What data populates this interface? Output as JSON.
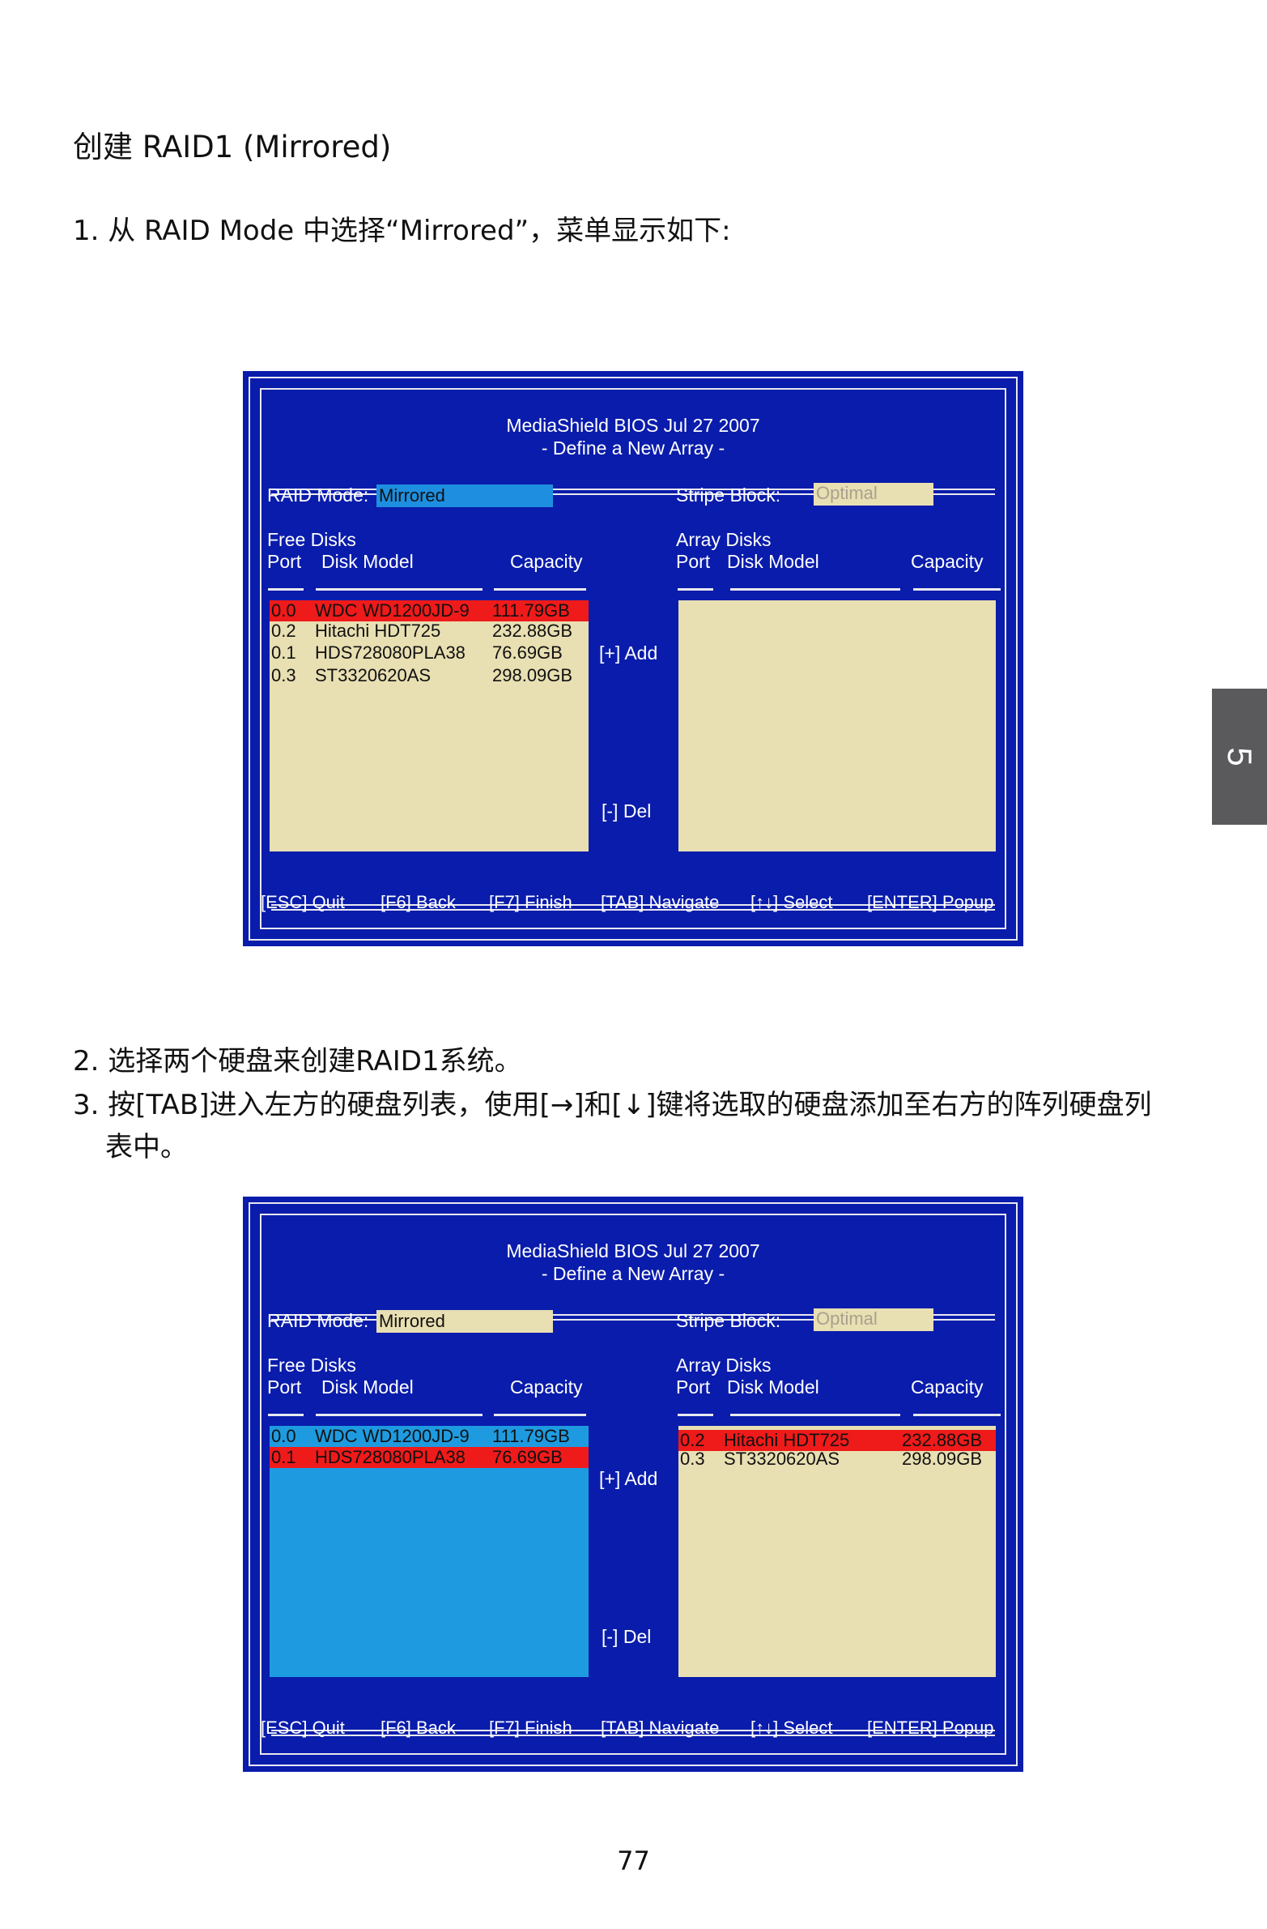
{
  "page": {
    "heading": "创建 RAID1 (Mirrored)",
    "step1": "1. 从 RAID Mode 中选择“Mirrored”，菜单显示如下:",
    "step2": "2. 选择两个硬盘来创建RAID1系统。",
    "step3_line1": "3. 按[TAB]进入左方的硬盘列表，使用[→]和[↓]键将选取的硬盘添加至右方的阵列硬盘列",
    "step3_line2": "表中。",
    "chapter_tab": "5",
    "page_number": "77"
  },
  "bios_common": {
    "title": "MediaShield BIOS   Jul 27 2007",
    "subtitle": "- Define a New Array -",
    "raid_mode_label": "RAID Mode:",
    "raid_mode_value": "Mirrored",
    "stripe_label": "Stripe Block:",
    "stripe_value": "Optimal",
    "free_disks_label": "Free Disks",
    "array_disks_label": "Array Disks",
    "col_port": "Port",
    "col_model": "Disk Model",
    "col_capacity": "Capacity",
    "add_label": "[+] Add",
    "del_label": "[-] Del",
    "footer": {
      "quit": "[ESC] Quit",
      "back": "[F6] Back",
      "finish": "[F7] Finish",
      "navigate": "[TAB] Navigate",
      "select": "[↑↓] Select",
      "popup": "[ENTER] Popup"
    }
  },
  "screen1": {
    "free_disks": [
      {
        "port": "0.0",
        "model": "WDC WD1200JD-9",
        "capacity": "111.79GB",
        "highlighted": true
      },
      {
        "port": "0.2",
        "model": "Hitachi HDT725",
        "capacity": "232.88GB",
        "highlighted": false
      },
      {
        "port": "0.1",
        "model": "HDS728080PLA38",
        "capacity": "76.69GB",
        "highlighted": false
      },
      {
        "port": "0.3",
        "model": "ST3320620AS",
        "capacity": "298.09GB",
        "highlighted": false
      }
    ],
    "array_disks": []
  },
  "screen2": {
    "free_disks": [
      {
        "port": "0.0",
        "model": "WDC WD1200JD-9",
        "capacity": "111.79GB",
        "highlighted": false
      },
      {
        "port": "0.1",
        "model": "HDS728080PLA38",
        "capacity": "76.69GB",
        "highlighted": true
      }
    ],
    "array_disks": [
      {
        "port": "0.2",
        "model": "Hitachi HDT725",
        "capacity": "232.88GB",
        "highlighted": true
      },
      {
        "port": "0.3",
        "model": "ST3320620AS",
        "capacity": "298.09GB",
        "highlighted": false
      }
    ]
  },
  "colors": {
    "bios_blue": "#0a1cab",
    "panel_tan": "#e8dfb2",
    "selection_blue": "#1e9be0",
    "highlight_red": "#ef1a1a"
  }
}
